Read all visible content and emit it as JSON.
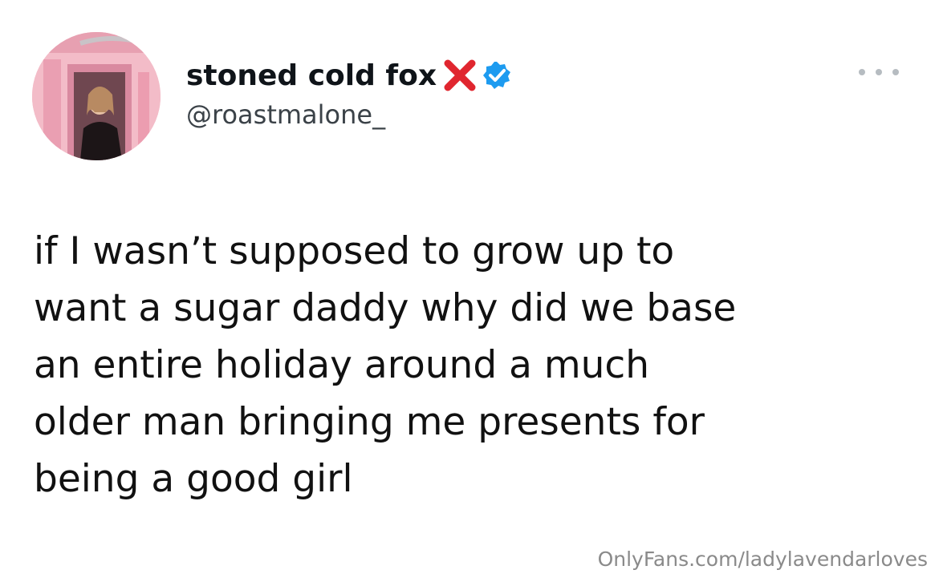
{
  "tweet": {
    "display_name": "stoned cold fox",
    "handle": "@roastmalone_",
    "text": "if I wasn’t supposed to grow up to\nwant a sugar daddy why did we base\nan entire holiday around a much\nolder man bringing me presents for\nbeing a good girl",
    "icons": {
      "x_mark": "red-x-icon",
      "verified": "verified-badge-icon",
      "more": "more-options-icon"
    }
  },
  "watermark": "OnlyFans.com/ladylavendarloves",
  "colors": {
    "x_mark": "#e0262f",
    "verified": "#1d9bf0",
    "watermark": "#8a8a8a"
  }
}
